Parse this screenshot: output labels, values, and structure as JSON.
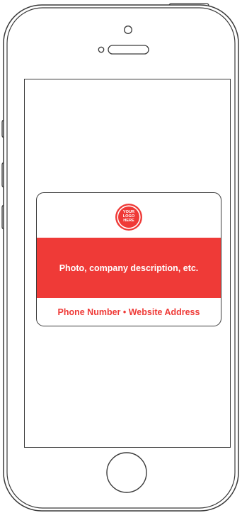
{
  "card": {
    "logo_lines": [
      "YOUR",
      "LOGO",
      "HERE"
    ],
    "banner_text": "Photo, company description, etc.",
    "footer_text": "Phone Number • Website Address"
  },
  "colors": {
    "brand_red": "#ef3a37",
    "outline": "#3a3a3a",
    "background": "#ffffff"
  },
  "icons": {
    "front_camera": "front-camera-icon",
    "speaker": "earpiece-speaker-icon",
    "home_button": "home-button-icon"
  }
}
